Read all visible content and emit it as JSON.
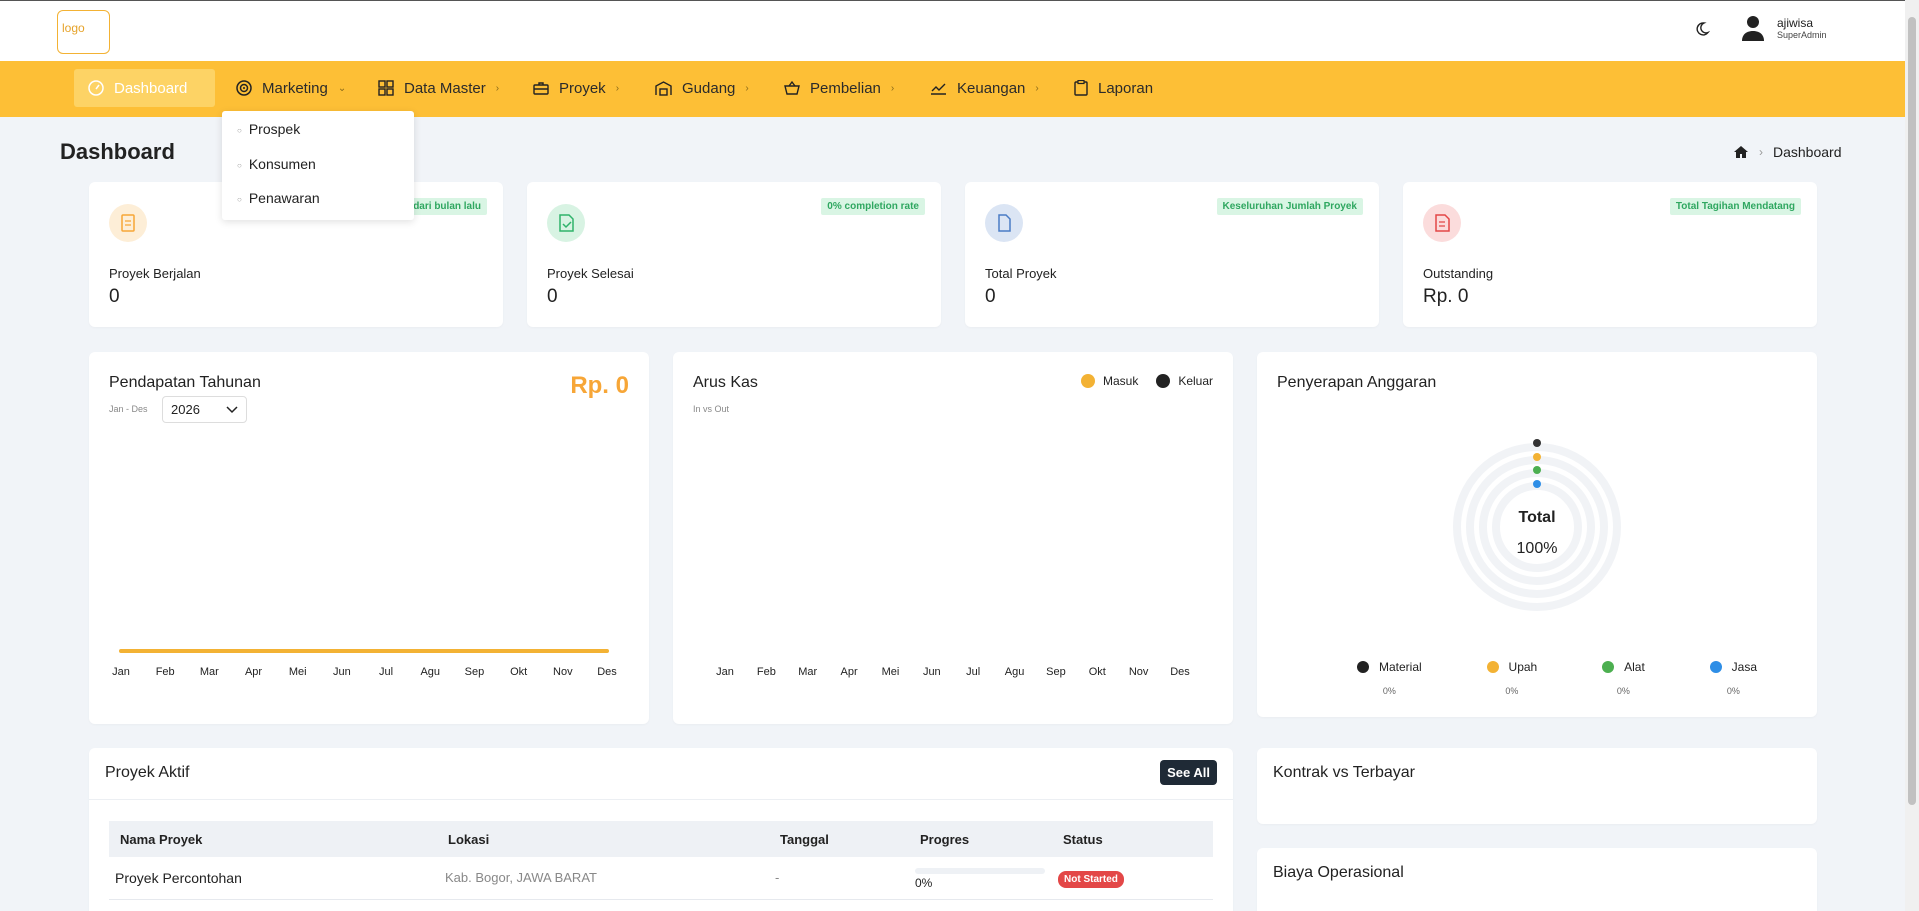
{
  "header": {
    "logo_alt": "logo",
    "user": {
      "name": "ajiwisa",
      "role": "SuperAdmin"
    }
  },
  "nav": {
    "items": [
      {
        "label": "Dashboard",
        "icon": "gauge-icon"
      },
      {
        "label": "Marketing",
        "icon": "target-icon"
      },
      {
        "label": "Data Master",
        "icon": "grid-icon"
      },
      {
        "label": "Proyek",
        "icon": "briefcase-icon"
      },
      {
        "label": "Gudang",
        "icon": "warehouse-icon"
      },
      {
        "label": "Pembelian",
        "icon": "basket-icon"
      },
      {
        "label": "Keuangan",
        "icon": "chart-line-icon"
      },
      {
        "label": "Laporan",
        "icon": "clipboard-icon"
      }
    ],
    "marketing_dropdown": [
      "Prospek",
      "Konsumen",
      "Penawaran"
    ]
  },
  "page": {
    "title": "Dashboard",
    "breadcrumb": "Dashboard"
  },
  "stats": [
    {
      "label": "Proyek Berjalan",
      "value": "0",
      "badge": "dari bulan lalu",
      "color": "#f7a637"
    },
    {
      "label": "Proyek Selesai",
      "value": "0",
      "badge": "0% completion rate",
      "color": "#2fb36b"
    },
    {
      "label": "Total Proyek",
      "value": "0",
      "badge": "Keseluruhan Jumlah Proyek",
      "color": "#4a7cc5"
    },
    {
      "label": "Outstanding",
      "value": "Rp. 0",
      "badge": "Total Tagihan Mendatang",
      "color": "#e34747"
    }
  ],
  "pendapatan": {
    "title": "Pendapatan Tahunan",
    "amount": "Rp. 0",
    "range_label": "Jan - Des",
    "year": "2026"
  },
  "arus_kas": {
    "title": "Arus Kas",
    "subtitle": "In vs Out",
    "legend": [
      {
        "name": "Masuk",
        "color": "#f3b234"
      },
      {
        "name": "Keluar",
        "color": "#222222"
      }
    ]
  },
  "penyerapan": {
    "title": "Penyerapan Anggaran",
    "center_title": "Total",
    "center_value": "100%",
    "legend": [
      {
        "name": "Material",
        "value": "0%",
        "color": "#222222"
      },
      {
        "name": "Upah",
        "value": "0%",
        "color": "#f3b234"
      },
      {
        "name": "Alat",
        "value": "0%",
        "color": "#4caf50"
      },
      {
        "name": "Jasa",
        "value": "0%",
        "color": "#2e8ee6"
      }
    ]
  },
  "chart_data": [
    {
      "type": "line",
      "title": "Pendapatan Tahunan",
      "categories": [
        "Jan",
        "Feb",
        "Mar",
        "Apr",
        "Mei",
        "Jun",
        "Jul",
        "Agu",
        "Sep",
        "Okt",
        "Nov",
        "Des"
      ],
      "values": [
        0,
        0,
        0,
        0,
        0,
        0,
        0,
        0,
        0,
        0,
        0,
        0
      ],
      "color": "#f3b234"
    },
    {
      "type": "line",
      "title": "Arus Kas",
      "categories": [
        "Jan",
        "Feb",
        "Mar",
        "Apr",
        "Mei",
        "Jun",
        "Jul",
        "Agu",
        "Sep",
        "Okt",
        "Nov",
        "Des"
      ],
      "series": [
        {
          "name": "Masuk",
          "values": []
        },
        {
          "name": "Keluar",
          "values": []
        }
      ]
    },
    {
      "type": "pie",
      "title": "Penyerapan Anggaran",
      "categories": [
        "Material",
        "Upah",
        "Alat",
        "Jasa"
      ],
      "values": [
        0,
        0,
        0,
        0
      ]
    }
  ],
  "proyek_aktif": {
    "title": "Proyek Aktif",
    "see_all": "See All",
    "columns": [
      "Nama Proyek",
      "Lokasi",
      "Tanggal",
      "Progres",
      "Status"
    ],
    "rows": [
      {
        "nama": "Proyek Percontohan",
        "lokasi": "Kab. Bogor, JAWA BARAT",
        "tanggal": "-",
        "progres": "0%",
        "progress_fraction": 0,
        "status": "Not Started"
      }
    ]
  },
  "side_cards": {
    "kontrak": "Kontrak vs Terbayar",
    "biaya": "Biaya Operasional"
  }
}
